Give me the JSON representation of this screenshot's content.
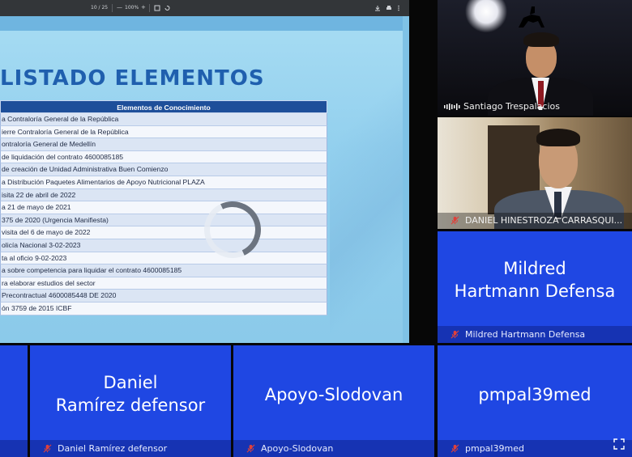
{
  "pdf_toolbar": {
    "page": "10 / 25",
    "zoom": "100%",
    "minus": "—",
    "plus": "+"
  },
  "slide": {
    "title": "LISTADO ELEMENTOS",
    "table_header": "Elementos de Conocimiento",
    "rows": [
      "a Contraloría General de la República",
      "ierre Contraloría General de la República",
      "ontraloría General de Medellín",
      "de liquidación del contrato 4600085185",
      "de creación de Unidad Administrativa Buen Comienzo",
      "a Distribución Paquetes Alimentarios de Apoyo Nutricional PLAZA",
      "isita 22 de abril de 2022",
      "a 21 de mayo de 2021",
      "375 de 2020 (Urgencia Manifiesta)",
      "visita del 6 de mayo de 2022",
      "olicía Nacional 3-02-2023",
      "ta al oficio 9-02-2023",
      "a sobre competencia para liquidar el contrato 4600085185",
      "ra elaborar estudios del sector",
      "Precontractual 4600085448 DE 2020",
      "ón 3759 de 2015 ICBF"
    ]
  },
  "participants": {
    "santiago": {
      "label": "Santiago Trespalacios"
    },
    "daniel_h": {
      "label": "DANIEL HINESTROZA CARRASQUI..."
    },
    "mildred": {
      "name_line1": "Mildred",
      "name_line2": "Hartmann Defensa",
      "label": "Mildred Hartmann Defensa"
    },
    "daniel_r": {
      "name_line1": "Daniel",
      "name_line2": "Ramírez  defensor",
      "label": "Daniel Ramírez  defensor"
    },
    "apoyo": {
      "name": "Apoyo-Slodovan",
      "label": "Apoyo-Slodovan"
    },
    "pmpal": {
      "name": "pmpal39med",
      "label": "pmpal39med"
    }
  },
  "colors": {
    "tile_blue": "#1f47e3",
    "mic_off": "#e0413b",
    "title_blue": "#1f5fae",
    "table_header": "#1e4f9a"
  }
}
